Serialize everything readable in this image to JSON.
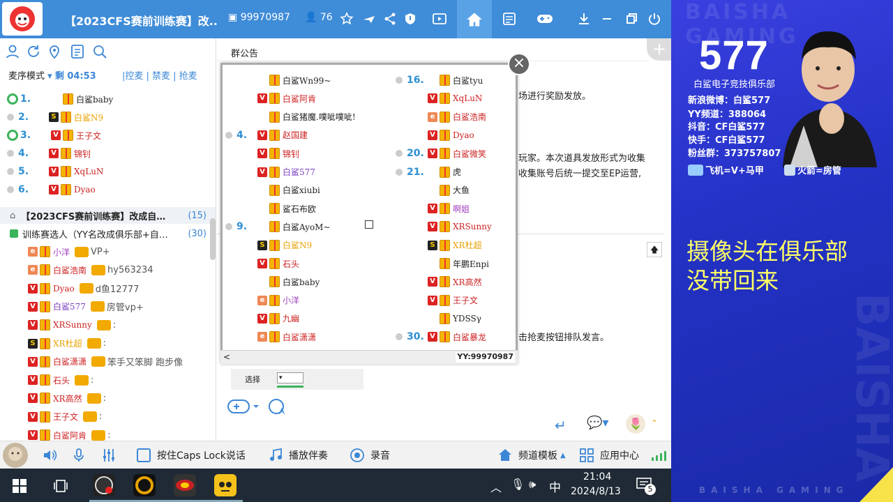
{
  "titlebar": {
    "title": "【2023CFS赛前训练赛】改...",
    "room_id": "99970987",
    "user_count": "76"
  },
  "left": {
    "mic_mode_label": "麦序模式",
    "mic_remaining": "剩 04:53",
    "links": "|控麦 | 禁麦 | 抢麦",
    "queue": [
      {
        "num": "1.",
        "name": "白鲨baby",
        "color": "#222"
      },
      {
        "num": "2.",
        "name": "白鲨N9",
        "color": "#e8a200"
      },
      {
        "num": "3.",
        "name": "王子文",
        "color": "#c22"
      },
      {
        "num": "4.",
        "name": "锦钊",
        "color": "#c22"
      },
      {
        "num": "5.",
        "name": "XqLuN",
        "color": "#c22"
      },
      {
        "num": "6.",
        "name": "Dyao",
        "color": "#c22"
      }
    ],
    "channel_name": "【2023CFS赛前训练赛】改成自…",
    "channel_count": "(15)",
    "sub_channel": "训练赛选人（YY名改成俱乐部+自…",
    "sub_count": "(30)",
    "users": [
      {
        "name": "小洋",
        "extra": "VP+",
        "color": "#a040c0"
      },
      {
        "name": "白鲨浩南",
        "extra": "hy563234",
        "color": "#c22"
      },
      {
        "name": "Dyao",
        "extra": "d鱼12777",
        "color": "#c22"
      },
      {
        "name": "白鲨577",
        "extra": "房管vp+",
        "color": "#7a3fc0"
      },
      {
        "name": "XRSunny",
        "extra": ":",
        "color": "#c22"
      },
      {
        "name": "XR杜超",
        "extra": ":",
        "color": "#e8a200"
      },
      {
        "name": "白鲨潇潇",
        "extra": "笨手又笨脚 跑步像",
        "color": "#c22"
      },
      {
        "name": "石头",
        "extra": ":",
        "color": "#c22"
      },
      {
        "name": "XR高然",
        "extra": ":",
        "color": "#c22"
      },
      {
        "name": "王子文",
        "extra": ":",
        "color": "#c22"
      },
      {
        "name": "白鲨阿肯",
        "extra": ":",
        "color": "#c22"
      }
    ]
  },
  "right": {
    "notice_title": "群公告",
    "notice_line1": "场进行奖励发放。",
    "notice_line2": "玩家。本次道具发放形式为收集",
    "notice_line3": "收集账号后统一提交至EP运营,",
    "notice_line4": "击抢麦按钮排队发言。",
    "select_label": "选择"
  },
  "popup": {
    "col1": [
      {
        "num": "",
        "name": "白鲨Wn99~",
        "color": "#222"
      },
      {
        "num": "",
        "name": "白鲨阿肯",
        "color": "#c22"
      },
      {
        "num": "",
        "name": "白鲨猪魔.噗呲噗呲!",
        "color": "#222"
      },
      {
        "num": "4.",
        "name": "赵国建",
        "color": "#c22"
      },
      {
        "num": "",
        "name": "锦钊",
        "color": "#c22"
      },
      {
        "num": "",
        "name": "白鲨577",
        "color": "#7a3fc0"
      },
      {
        "num": "",
        "name": "白鲨xiubi",
        "color": "#222"
      },
      {
        "num": "",
        "name": "鲨石布欧",
        "color": "#222"
      },
      {
        "num": "9.",
        "name": "白鲨AyoM~",
        "color": "#222"
      },
      {
        "num": "",
        "name": "白鲨N9",
        "color": "#e8a200"
      },
      {
        "num": "",
        "name": "石头",
        "color": "#c22"
      },
      {
        "num": "",
        "name": "白鲨baby",
        "color": "#222"
      },
      {
        "num": "",
        "name": "小洋",
        "color": "#a040c0"
      },
      {
        "num": "",
        "name": "九幽",
        "color": "#c22"
      },
      {
        "num": "",
        "name": "白鲨潇潇",
        "color": "#c22"
      }
    ],
    "col2": [
      {
        "num": "16.",
        "name": "白鲨tyu",
        "color": "#222"
      },
      {
        "num": "",
        "name": "XqLuN",
        "color": "#c22"
      },
      {
        "num": "",
        "name": "白鲨浩南",
        "color": "#c22"
      },
      {
        "num": "",
        "name": "Dyao",
        "color": "#c22"
      },
      {
        "num": "20.",
        "name": "白鲨微笑",
        "color": "#c22"
      },
      {
        "num": "21.",
        "name": "虎",
        "color": "#222"
      },
      {
        "num": "",
        "name": "大鱼",
        "color": "#222"
      },
      {
        "num": "",
        "name": "啊姐",
        "color": "#a040c0"
      },
      {
        "num": "",
        "name": "XRSunny",
        "color": "#c22"
      },
      {
        "num": "",
        "name": "XR杜超",
        "color": "#e8a200"
      },
      {
        "num": "",
        "name": "年鹏Enpi",
        "color": "#222"
      },
      {
        "num": "",
        "name": "XR高然",
        "color": "#c22"
      },
      {
        "num": "",
        "name": "王子文",
        "color": "#c22"
      },
      {
        "num": "",
        "name": "YDSSγ",
        "color": "#222"
      },
      {
        "num": "30.",
        "name": "白鲨暴龙",
        "color": "#c22"
      }
    ],
    "watermark": "YY:99970987"
  },
  "bottom": {
    "caps_label": "按住Caps Lock说话",
    "music_label": "播放伴奏",
    "record_label": "录音",
    "template_label": "频道模板",
    "apps_label": "应用中心"
  },
  "taskbar": {
    "time": "21:04",
    "date": "2024/8/13",
    "ime": "中",
    "notif_count": "5"
  },
  "stream": {
    "big_id": "577",
    "club": "白鲨电子竞技俱乐部",
    "weibo": "新浪微博：白鲨577",
    "yy": "YY频道：388064",
    "douyin": "抖音：CF白鲨577",
    "kuaishou": "快手：CF白鲨577",
    "fans": "粉丝群：373757807",
    "perk1": "飞机=V+马甲",
    "perk2": "火箭=房管",
    "caption1": "摄像头在俱乐部",
    "caption2": "没带回来",
    "brand": "BAISHA GAMING"
  }
}
